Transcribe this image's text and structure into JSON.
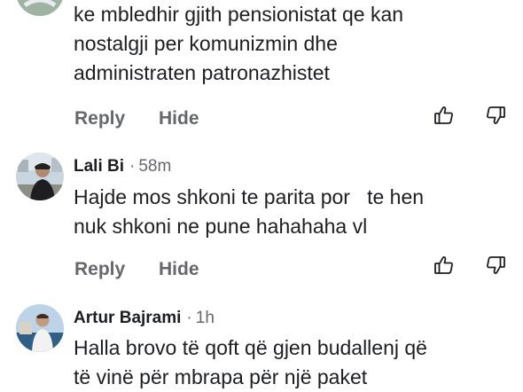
{
  "comments": [
    {
      "author": "",
      "time": "",
      "text": "ke mbledhir gjith pensionistat qe kan\nnostalgji per komunizmin dhe\nadministraten patronazhistet",
      "actions": {
        "reply": "Reply",
        "hide": "Hide"
      },
      "icons": {
        "like": "thumbs-up-icon",
        "dislike": "thumbs-down-icon"
      }
    },
    {
      "author": "Lali Bi",
      "separator": "·",
      "time": "58m",
      "text": "Hajde mos shkoni te parita por   te hen\nnuk shkoni ne pune hahahaha vl",
      "actions": {
        "reply": "Reply",
        "hide": "Hide"
      },
      "icons": {
        "like": "thumbs-up-icon",
        "dislike": "thumbs-down-icon"
      }
    },
    {
      "author": "Artur Bajrami",
      "separator": "·",
      "time": "1h",
      "text": "Halla brovo të qoft që gjen budallenj që\ntë vinë për mbrapa për një paket"
    }
  ],
  "colors": {
    "text": "#1c1e21",
    "secondary": "#65676b"
  }
}
